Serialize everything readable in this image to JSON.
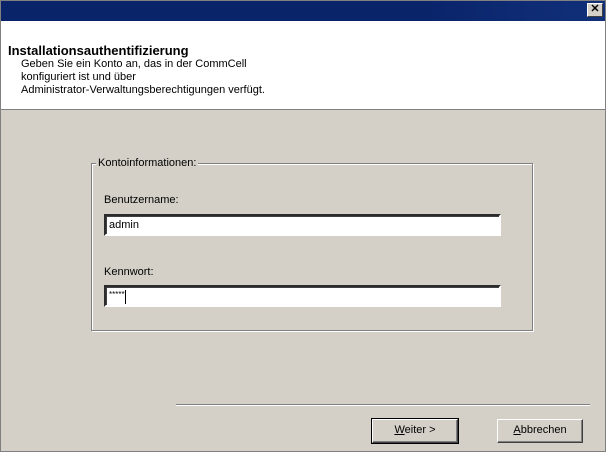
{
  "window": {
    "close_glyph": "✕"
  },
  "header": {
    "title": "Installationsauthentifizierung",
    "description_lines": [
      "Geben Sie ein Konto an, das in der CommCell",
      "konfiguriert ist und über",
      "Administrator-Verwaltungsberechtigungen verfügt."
    ]
  },
  "account_group": {
    "legend": "Kontoinformationen:",
    "username_label": "Benutzername:",
    "username_value": "admin",
    "password_label": "Kennwort:",
    "password_value": "*****"
  },
  "buttons": {
    "next": {
      "mnemonic": "W",
      "rest": "eiter >"
    },
    "cancel": {
      "mnemonic": "A",
      "rest": "bbrechen"
    }
  },
  "colors": {
    "titlebar": "#0a246a",
    "dialog_face": "#d4d0c8"
  }
}
